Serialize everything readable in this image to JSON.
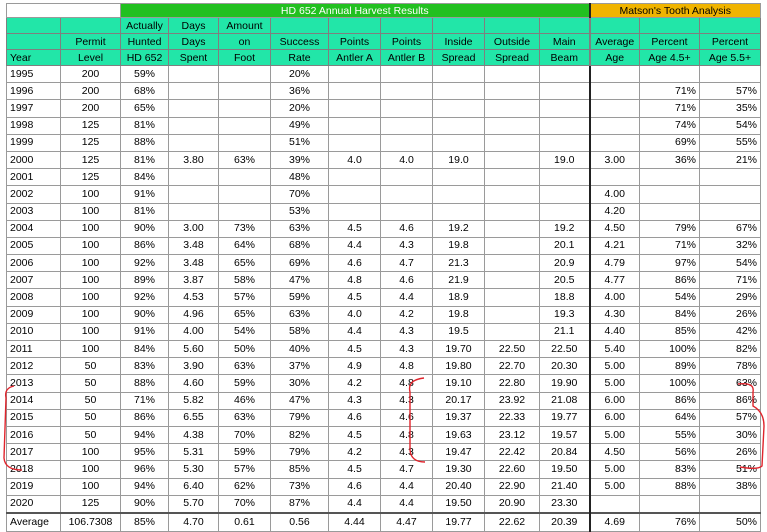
{
  "title_main": "HD 652 Annual Harvest Results",
  "title_matson": "Matson's Tooth Analysis",
  "headers": [
    [
      "",
      "Year"
    ],
    [
      "",
      "Permit",
      "Level"
    ],
    [
      "Actually",
      "Hunted",
      "HD 652"
    ],
    [
      "Days",
      "Days",
      "Spent"
    ],
    [
      "Amount",
      "on",
      "Foot"
    ],
    [
      "",
      "Success",
      "Rate"
    ],
    [
      "",
      "Points",
      "Antler A"
    ],
    [
      "",
      "Points",
      "Antler B"
    ],
    [
      "",
      "Inside",
      "Spread"
    ],
    [
      "",
      "Outside",
      "Spread"
    ],
    [
      "",
      "Main",
      "Beam"
    ],
    [
      "",
      "Average",
      "Age"
    ],
    [
      "",
      "Percent",
      "Age 4.5+"
    ],
    [
      "",
      "Percent",
      "Age 5.5+"
    ]
  ],
  "rows": [
    [
      "1995",
      "200",
      "59%",
      "",
      "",
      "20%",
      "",
      "",
      "",
      "",
      "",
      "",
      "",
      ""
    ],
    [
      "1996",
      "200",
      "68%",
      "",
      "",
      "36%",
      "",
      "",
      "",
      "",
      "",
      "",
      "71%",
      "57%"
    ],
    [
      "1997",
      "200",
      "65%",
      "",
      "",
      "20%",
      "",
      "",
      "",
      "",
      "",
      "",
      "71%",
      "35%"
    ],
    [
      "1998",
      "125",
      "81%",
      "",
      "",
      "49%",
      "",
      "",
      "",
      "",
      "",
      "",
      "74%",
      "54%"
    ],
    [
      "1999",
      "125",
      "88%",
      "",
      "",
      "51%",
      "",
      "",
      "",
      "",
      "",
      "",
      "69%",
      "55%"
    ],
    [
      "2000",
      "125",
      "81%",
      "3.80",
      "63%",
      "39%",
      "4.0",
      "4.0",
      "19.0",
      "",
      "19.0",
      "3.00",
      "36%",
      "21%"
    ],
    [
      "2001",
      "125",
      "84%",
      "",
      "",
      "48%",
      "",
      "",
      "",
      "",
      "",
      "",
      "",
      ""
    ],
    [
      "2002",
      "100",
      "91%",
      "",
      "",
      "70%",
      "",
      "",
      "",
      "",
      "",
      "4.00",
      "",
      ""
    ],
    [
      "2003",
      "100",
      "81%",
      "",
      "",
      "53%",
      "",
      "",
      "",
      "",
      "",
      "4.20",
      "",
      ""
    ],
    [
      "2004",
      "100",
      "90%",
      "3.00",
      "73%",
      "63%",
      "4.5",
      "4.6",
      "19.2",
      "",
      "19.2",
      "4.50",
      "79%",
      "67%"
    ],
    [
      "2005",
      "100",
      "86%",
      "3.48",
      "64%",
      "68%",
      "4.4",
      "4.3",
      "19.8",
      "",
      "20.1",
      "4.21",
      "71%",
      "32%"
    ],
    [
      "2006",
      "100",
      "92%",
      "3.48",
      "65%",
      "69%",
      "4.6",
      "4.7",
      "21.3",
      "",
      "20.9",
      "4.79",
      "97%",
      "54%"
    ],
    [
      "2007",
      "100",
      "89%",
      "3.87",
      "58%",
      "47%",
      "4.8",
      "4.6",
      "21.9",
      "",
      "20.5",
      "4.77",
      "86%",
      "71%"
    ],
    [
      "2008",
      "100",
      "92%",
      "4.53",
      "57%",
      "59%",
      "4.5",
      "4.4",
      "18.9",
      "",
      "18.8",
      "4.00",
      "54%",
      "29%"
    ],
    [
      "2009",
      "100",
      "90%",
      "4.96",
      "65%",
      "63%",
      "4.0",
      "4.2",
      "19.8",
      "",
      "19.3",
      "4.30",
      "84%",
      "26%"
    ],
    [
      "2010",
      "100",
      "91%",
      "4.00",
      "54%",
      "58%",
      "4.4",
      "4.3",
      "19.5",
      "",
      "21.1",
      "4.40",
      "85%",
      "42%"
    ],
    [
      "2011",
      "100",
      "84%",
      "5.60",
      "50%",
      "40%",
      "4.5",
      "4.3",
      "19.70",
      "22.50",
      "22.50",
      "5.40",
      "100%",
      "82%"
    ],
    [
      "2012",
      "50",
      "83%",
      "3.90",
      "63%",
      "37%",
      "4.9",
      "4.8",
      "19.80",
      "22.70",
      "20.30",
      "5.00",
      "89%",
      "78%"
    ],
    [
      "2013",
      "50",
      "88%",
      "4.60",
      "59%",
      "30%",
      "4.2",
      "4.8",
      "19.10",
      "22.80",
      "19.90",
      "5.00",
      "100%",
      "63%"
    ],
    [
      "2014",
      "50",
      "71%",
      "5.82",
      "46%",
      "47%",
      "4.3",
      "4.3",
      "20.17",
      "23.92",
      "21.08",
      "6.00",
      "86%",
      "86%"
    ],
    [
      "2015",
      "50",
      "86%",
      "6.55",
      "63%",
      "79%",
      "4.6",
      "4.6",
      "19.37",
      "22.33",
      "19.77",
      "6.00",
      "64%",
      "57%"
    ],
    [
      "2016",
      "50",
      "94%",
      "4.38",
      "70%",
      "82%",
      "4.5",
      "4.8",
      "19.63",
      "23.12",
      "19.57",
      "5.00",
      "55%",
      "30%"
    ],
    [
      "2017",
      "100",
      "95%",
      "5.31",
      "59%",
      "79%",
      "4.2",
      "4.3",
      "19.47",
      "22.42",
      "20.84",
      "4.50",
      "56%",
      "26%"
    ],
    [
      "2018",
      "100",
      "96%",
      "5.30",
      "57%",
      "85%",
      "4.5",
      "4.7",
      "19.30",
      "22.60",
      "19.50",
      "5.00",
      "83%",
      "51%"
    ],
    [
      "2019",
      "100",
      "94%",
      "6.40",
      "62%",
      "73%",
      "4.6",
      "4.4",
      "20.40",
      "22.90",
      "21.40",
      "5.00",
      "88%",
      "38%"
    ],
    [
      "2020",
      "125",
      "90%",
      "5.70",
      "70%",
      "87%",
      "4.4",
      "4.4",
      "19.50",
      "20.90",
      "23.30",
      "",
      "",
      ""
    ]
  ],
  "average_row": [
    "Average",
    "106.7308",
    "85%",
    "4.70",
    "0.61",
    "0.56",
    "4.44",
    "4.47",
    "19.77",
    "22.62",
    "20.39",
    "4.69",
    "76%",
    "50%"
  ],
  "annotation_color": "#e0242c"
}
